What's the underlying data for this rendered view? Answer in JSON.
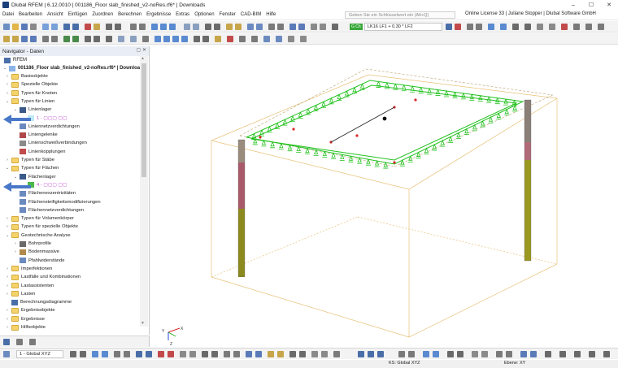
{
  "window": {
    "title": "Dlubal RFEM | 6.12.0010 | 001186_Floor slab_finished_v2-noRes.rf6* | Downloads",
    "controls": [
      "–",
      "☐",
      "✕"
    ]
  },
  "menu": {
    "items": [
      "Datei",
      "Bearbeiten",
      "Ansicht",
      "Einfügen",
      "Zuordnen",
      "Berechnen",
      "Ergebnisse",
      "Extras",
      "Optionen",
      "Fenster",
      "CAD-BIM",
      "Hilfe"
    ],
    "search_placeholder": "Geben Sie ein Schlüsselwort ein (Alt+Q)",
    "license": "Online License 33 | Juliane Stopper | Dlubal Software GmbH"
  },
  "toolbar": {
    "load_badge": "G Ch",
    "load_case": "LK16    LF1 + 0.30 * LF2"
  },
  "navigator": {
    "title": "Navigator - Daten",
    "root": "RFEM",
    "project": "001186_Floor slab_finished_v2-noRes.rf6* | Download",
    "rows": [
      {
        "label": "Basisobjekte",
        "type": "folder",
        "level": 1,
        "exp": "›"
      },
      {
        "label": "Spezielle Objekte",
        "type": "folder",
        "level": 1,
        "exp": "›"
      },
      {
        "label": "Typen für Knoten",
        "type": "folder",
        "level": 1,
        "exp": "›"
      },
      {
        "label": "Typen für Linien",
        "type": "folder",
        "level": 1,
        "exp": "⌄"
      },
      {
        "label": "Linienlager",
        "type": "support",
        "level": 2,
        "exp": "⌄"
      },
      {
        "label": "1 - ▢▢▢  ▢▢",
        "type": "item-cyan",
        "level": 3,
        "exp": ""
      },
      {
        "label": "Liniennetzverdichtungen",
        "type": "mesh",
        "level": 2,
        "exp": ""
      },
      {
        "label": "Liniengelenke",
        "type": "hinge",
        "level": 2,
        "exp": ""
      },
      {
        "label": "Linienschweißverbindungen",
        "type": "weld",
        "level": 2,
        "exp": ""
      },
      {
        "label": "Linienkopplungen",
        "type": "coupling",
        "level": 2,
        "exp": ""
      },
      {
        "label": "Typen für Stäbe",
        "type": "folder",
        "level": 1,
        "exp": "›"
      },
      {
        "label": "Typen für Flächen",
        "type": "folder",
        "level": 1,
        "exp": "⌄"
      },
      {
        "label": "Flächenlager",
        "type": "support",
        "level": 2,
        "exp": "⌄"
      },
      {
        "label": "4 - ▢▢▢  ▢▢",
        "type": "item-green",
        "level": 3,
        "exp": ""
      },
      {
        "label": "Flächenexzentrizitäten",
        "type": "mesh",
        "level": 2,
        "exp": ""
      },
      {
        "label": "Flächensteifigkeitsmodifizierungen",
        "type": "mesh",
        "level": 2,
        "exp": ""
      },
      {
        "label": "Flächennetzverdichtungen",
        "type": "mesh",
        "level": 2,
        "exp": ""
      },
      {
        "label": "Typen für Volumenkörper",
        "type": "folder",
        "level": 1,
        "exp": "›"
      },
      {
        "label": "Typen für spezielle Objekte",
        "type": "folder",
        "level": 1,
        "exp": "›"
      },
      {
        "label": "Geotechnische Analyse",
        "type": "folder",
        "level": 1,
        "exp": "⌄"
      },
      {
        "label": "Bohrprofile",
        "type": "pile",
        "level": 2,
        "exp": "›"
      },
      {
        "label": "Bodenmassive",
        "type": "soil",
        "level": 2,
        "exp": "›"
      },
      {
        "label": "Pfahlwiderstände",
        "type": "mesh",
        "level": 2,
        "exp": ""
      },
      {
        "label": "Imperfektionen",
        "type": "folder",
        "level": 1,
        "exp": "›"
      },
      {
        "label": "Lastfälle und Kombinationen",
        "type": "folder",
        "level": 1,
        "exp": "›"
      },
      {
        "label": "Lastassistenten",
        "type": "folder",
        "level": 1,
        "exp": "›"
      },
      {
        "label": "Lasten",
        "type": "folder",
        "level": 1,
        "exp": "›"
      },
      {
        "label": "Berechnungsdiagramme",
        "type": "diagram",
        "level": 1,
        "exp": ""
      },
      {
        "label": "Ergebnisobjekte",
        "type": "folder",
        "level": 1,
        "exp": "›"
      },
      {
        "label": "Ergebnisse",
        "type": "folder",
        "level": 1,
        "exp": "›"
      },
      {
        "label": "Hilfsobjekte",
        "type": "folder",
        "level": 1,
        "exp": "›"
      }
    ]
  },
  "viewport": {
    "axes": {
      "x": "X",
      "y": "Y",
      "z": "Z"
    }
  },
  "bottom": {
    "coordinate_system": "1 - Global XYZ"
  },
  "status": {
    "ks": "KS: Global XYZ",
    "ebene": "Ebene: XY"
  },
  "colors": {
    "accent": "#4a78c8",
    "support_green": "#22c11e",
    "column_top": "#8a7a6a",
    "column_mid": "#b05060",
    "column_base": "#a0a020",
    "slab_edge": "#d4b060"
  }
}
